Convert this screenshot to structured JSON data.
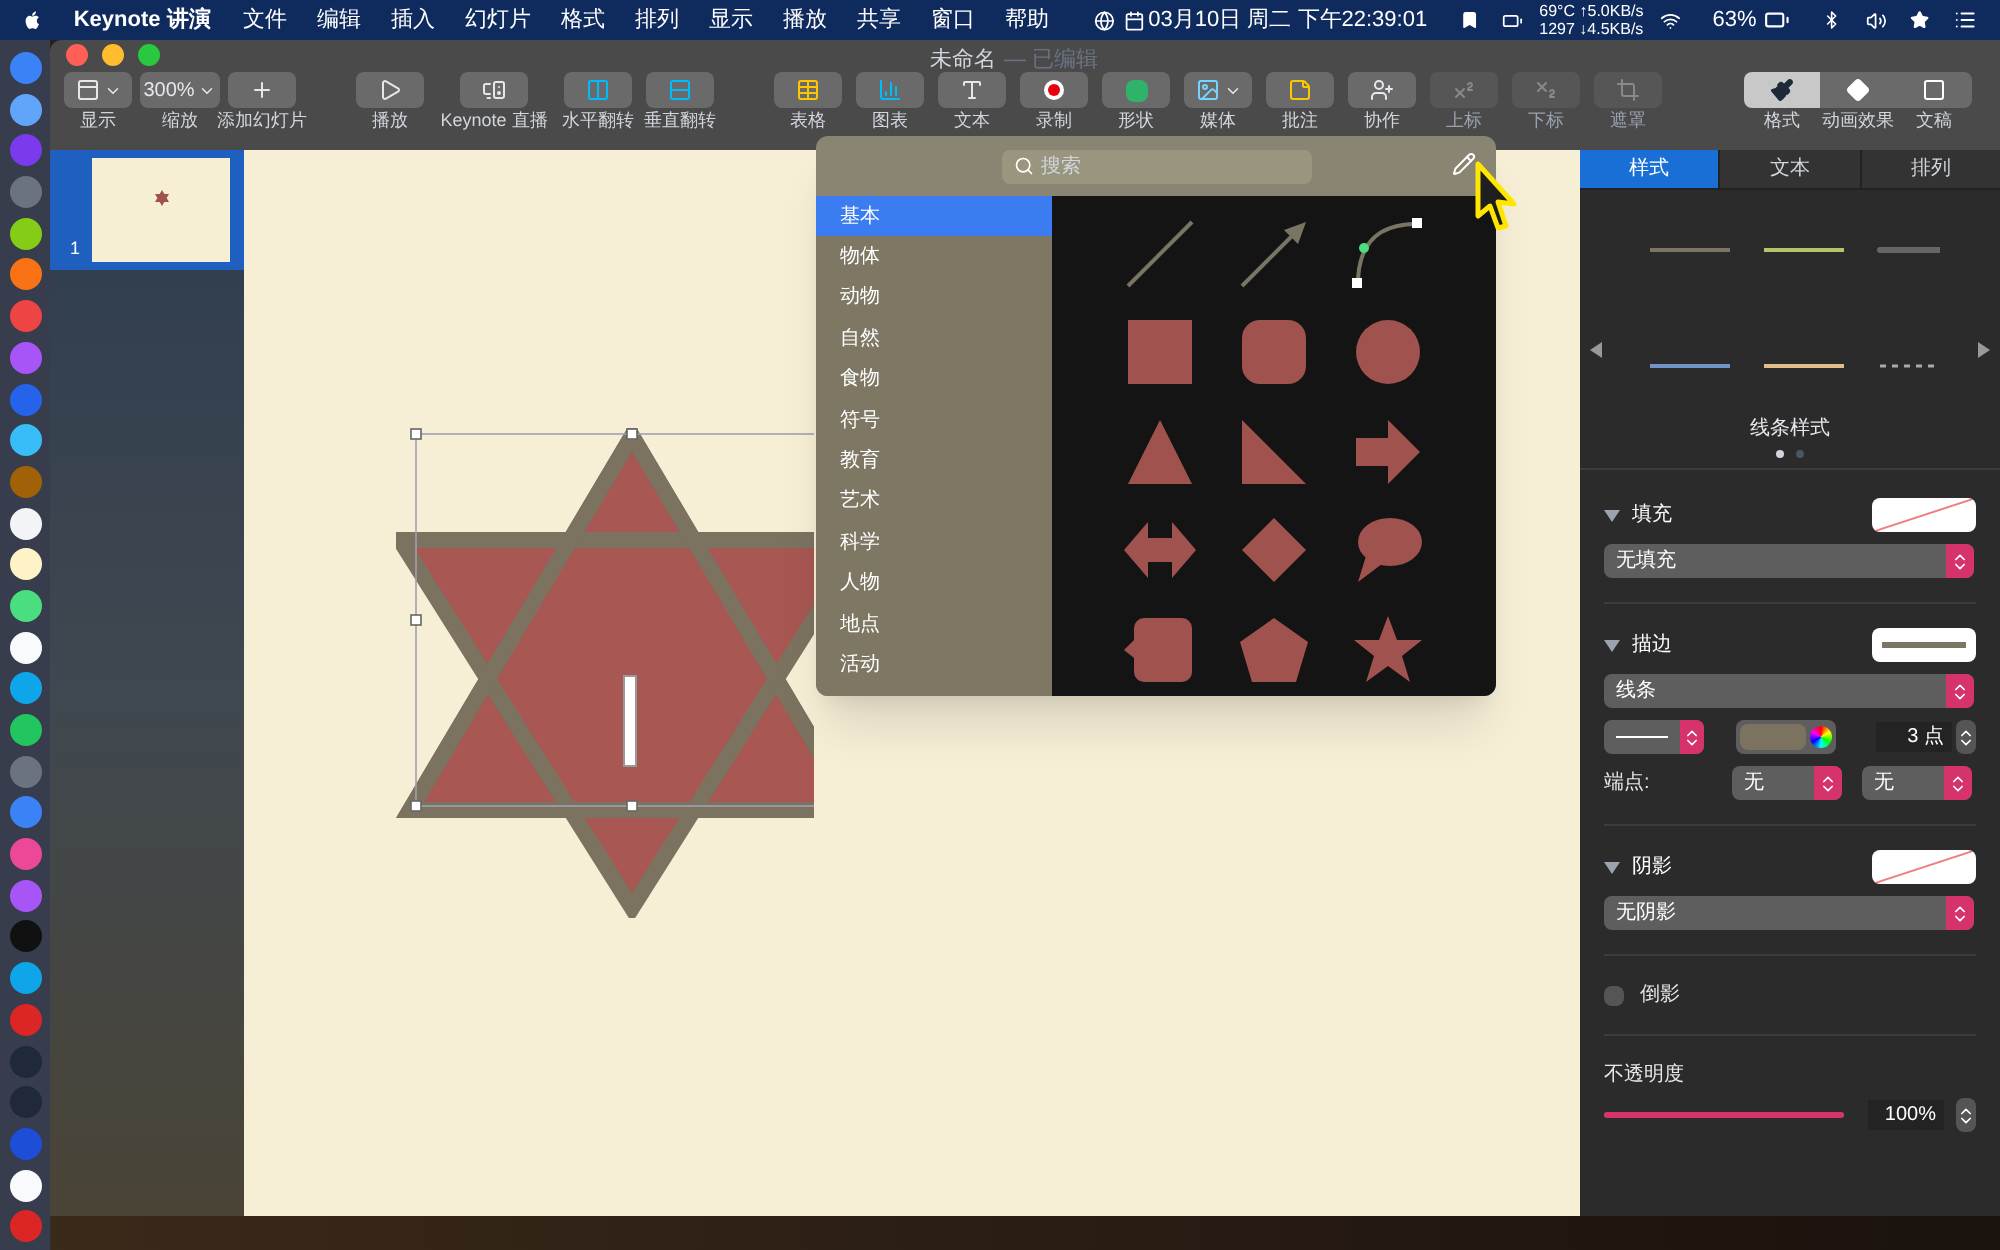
{
  "menu_bar": {
    "app": "Keynote 讲演",
    "items": [
      "文件",
      "编辑",
      "插入",
      "幻灯片",
      "格式",
      "排列",
      "显示",
      "播放",
      "共享",
      "窗口",
      "帮助"
    ],
    "clock": "03月10日 周二 下午22:39:01",
    "stats_top": "69°C ↑5.0KB/s",
    "stats_bottom": "1297 ↓4.5KB/s",
    "battery": "63%"
  },
  "window": {
    "title": "未命名",
    "status": "— 已编辑"
  },
  "toolbar": {
    "groups": [
      [
        {
          "kind": "view",
          "label": "显示",
          "disabled": false
        },
        {
          "kind": "zoom",
          "label": "缩放",
          "value": "300%",
          "disabled": false
        },
        {
          "kind": "add",
          "label": "添加幻灯片",
          "disabled": false
        }
      ],
      [
        {
          "kind": "play",
          "label": "播放",
          "disabled": false
        },
        {
          "kind": "live",
          "label": "Keynote 直播",
          "disabled": false
        },
        {
          "kind": "flip-h",
          "label": "水平翻转",
          "disabled": false
        },
        {
          "kind": "flip-v",
          "label": "垂直翻转",
          "disabled": false
        }
      ],
      [
        {
          "kind": "table",
          "label": "表格",
          "disabled": false
        },
        {
          "kind": "chart",
          "label": "图表",
          "disabled": false
        },
        {
          "kind": "text",
          "label": "文本",
          "disabled": false
        },
        {
          "kind": "record",
          "label": "录制",
          "disabled": false
        },
        {
          "kind": "shape",
          "label": "形状",
          "disabled": false
        },
        {
          "kind": "media",
          "label": "媒体",
          "disabled": false
        },
        {
          "kind": "comment",
          "label": "批注",
          "disabled": false
        },
        {
          "kind": "collab",
          "label": "协作",
          "disabled": false
        },
        {
          "kind": "sup",
          "label": "上标",
          "disabled": true
        },
        {
          "kind": "sub",
          "label": "下标",
          "disabled": true
        },
        {
          "kind": "mask",
          "label": "遮罩",
          "disabled": true
        }
      ]
    ],
    "panes": [
      {
        "kind": "format",
        "label": "格式",
        "selected": true
      },
      {
        "kind": "animate",
        "label": "动画效果",
        "selected": false
      },
      {
        "kind": "document",
        "label": "文稿",
        "selected": false
      }
    ]
  },
  "slides": [
    {
      "number": "1",
      "selected": true
    }
  ],
  "shape_popover": {
    "search": {
      "placeholder": "搜索"
    },
    "categories": [
      {
        "label": "基本",
        "selected": true
      },
      {
        "label": "物体",
        "selected": false
      },
      {
        "label": "动物",
        "selected": false
      },
      {
        "label": "自然",
        "selected": false
      },
      {
        "label": "食物",
        "selected": false
      },
      {
        "label": "符号",
        "selected": false
      },
      {
        "label": "教育",
        "selected": false
      },
      {
        "label": "艺术",
        "selected": false
      },
      {
        "label": "科学",
        "selected": false
      },
      {
        "label": "人物",
        "selected": false
      },
      {
        "label": "地点",
        "selected": false
      },
      {
        "label": "活动",
        "selected": false
      }
    ],
    "shapes": [
      {
        "kind": "line"
      },
      {
        "kind": "arrow"
      },
      {
        "kind": "curve"
      },
      {
        "kind": "square"
      },
      {
        "kind": "rounded"
      },
      {
        "kind": "circle"
      },
      {
        "kind": "triangle"
      },
      {
        "kind": "right-triangle"
      },
      {
        "kind": "arrow-right"
      },
      {
        "kind": "double-arrow"
      },
      {
        "kind": "diamond"
      },
      {
        "kind": "speech"
      },
      {
        "kind": "callout"
      },
      {
        "kind": "pentagon"
      },
      {
        "kind": "star"
      }
    ]
  },
  "inspector": {
    "tabs": [
      {
        "label": "样式",
        "selected": true
      },
      {
        "label": "文本",
        "selected": false
      },
      {
        "label": "排列",
        "selected": false
      }
    ],
    "caption": "线条样式",
    "page_dots": [
      {
        "selected": true
      },
      {
        "selected": false
      }
    ],
    "fill": {
      "title": "填充",
      "expanded": true,
      "value": "无填充"
    },
    "stroke": {
      "title": "描边",
      "expanded": true,
      "value": "线条",
      "width": "3 点",
      "endpoints_label": "端点:",
      "endpoints": [
        "无",
        "无"
      ]
    },
    "shadow": {
      "title": "阴影",
      "expanded": true,
      "value": "无阴影"
    },
    "reflection": {
      "label": "倒影",
      "checked": false
    },
    "opacity": {
      "label": "不透明度",
      "level": 1,
      "value": "100%"
    }
  }
}
